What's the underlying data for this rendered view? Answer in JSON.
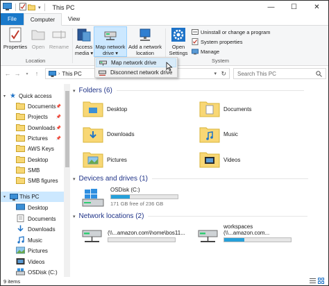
{
  "window": {
    "title": "This PC",
    "controls": {
      "minimize": "—",
      "maximize": "☐",
      "close": "✕"
    }
  },
  "tabs": [
    {
      "label": "File"
    },
    {
      "label": "Computer"
    },
    {
      "label": "View"
    }
  ],
  "ribbon": {
    "location_group": {
      "label": "Location",
      "properties": "Properties",
      "open": "Open",
      "rename": "Rename"
    },
    "network_group": {
      "access_media_1": "Access",
      "access_media_2": "media ▾",
      "map_drive_1": "Map network",
      "map_drive_2": "drive ▾",
      "add_location_1": "Add a network",
      "add_location_2": "location"
    },
    "system_group": {
      "label": "System",
      "open_settings_1": "Open",
      "open_settings_2": "Settings",
      "uninstall": "Uninstall or change a program",
      "system_properties": "System properties",
      "manage": "Manage"
    }
  },
  "dropdown": {
    "map_network_drive": "Map network drive",
    "disconnect_network_drive": "Disconnect network drive"
  },
  "address": {
    "path": "This PC",
    "search_placeholder": "Search This PC"
  },
  "sidebar": {
    "quick_access": "Quick access",
    "qa_items": [
      {
        "label": "Documents"
      },
      {
        "label": "Projects"
      },
      {
        "label": "Downloads"
      },
      {
        "label": "Pictures"
      },
      {
        "label": "AWS Keys"
      },
      {
        "label": "Desktop"
      },
      {
        "label": "SMB"
      },
      {
        "label": "SMB figures"
      }
    ],
    "this_pc": "This PC",
    "pc_items": [
      {
        "label": "Desktop"
      },
      {
        "label": "Documents"
      },
      {
        "label": "Downloads"
      },
      {
        "label": "Music"
      },
      {
        "label": "Pictures"
      },
      {
        "label": "Videos"
      },
      {
        "label": "OSDisk (C:)"
      }
    ]
  },
  "content": {
    "folders_header": "Folders (6)",
    "folders": [
      {
        "label": "Desktop"
      },
      {
        "label": "Documents"
      },
      {
        "label": "Downloads"
      },
      {
        "label": "Music"
      },
      {
        "label": "Pictures"
      },
      {
        "label": "Videos"
      }
    ],
    "drives_header": "Devices and drives (1)",
    "drive": {
      "name": "OSDisk (C:)",
      "free": "171 GB free of 236 GB",
      "used_fraction": 0.28
    },
    "network_header": "Network locations (2)",
    "network": [
      {
        "name": "",
        "path": "(\\\\...amazon.com\\home\\bos11...",
        "used_fraction": 0.0
      },
      {
        "name": "workspaces",
        "path": "(\\\\...amazon.com...",
        "used_fraction": 0.3
      }
    ]
  },
  "status": {
    "items": "9 items"
  },
  "colors": {
    "accent": "#1979ca",
    "selection": "#cce8ff",
    "section_header": "#1e3287",
    "drive_bar": "#26a0da"
  }
}
